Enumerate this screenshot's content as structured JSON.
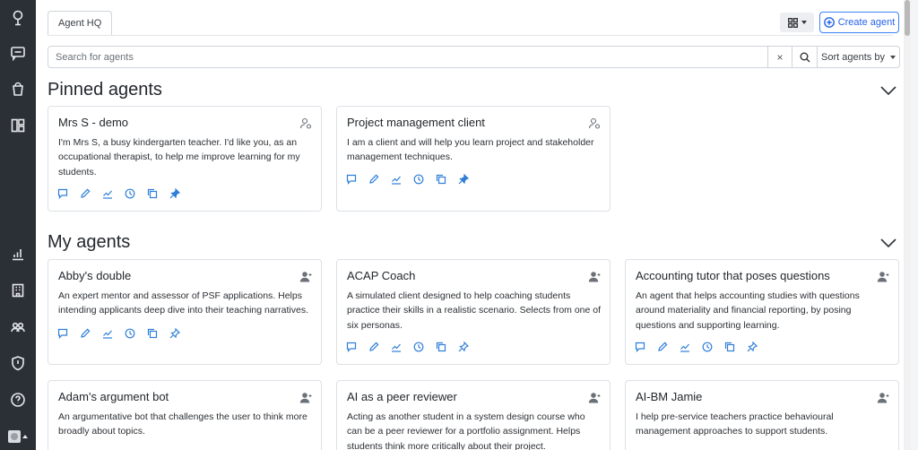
{
  "header": {
    "tab_label": "Agent HQ",
    "create_label": "Create agent"
  },
  "search": {
    "placeholder": "Search for agents",
    "clear_label": "×",
    "sort_label": "Sort agents by"
  },
  "sections": {
    "pinned_title": "Pinned agents",
    "my_title": "My agents"
  },
  "pinned": [
    {
      "title": "Mrs S - demo",
      "desc": "I'm Mrs S, a busy kindergarten teacher. I'd like you, as an occupational therapist, to help me improve learning for my students."
    },
    {
      "title": "Project management client",
      "desc": "I am a client and will help you learn project and stakeholder management techniques."
    }
  ],
  "agents": [
    {
      "title": "Abby's double",
      "desc": "An expert mentor and assessor of PSF applications. Helps intending applicants deep dive into their teaching narratives."
    },
    {
      "title": "ACAP Coach",
      "desc": "A simulated client designed to help coaching students practice their skills in a realistic scenario. Selects from one of six personas."
    },
    {
      "title": "Accounting tutor that poses questions",
      "desc": "An agent that helps accounting studies with questions around materiality and financial reporting, by posing questions and supporting learning."
    },
    {
      "title": "Adam's argument bot",
      "desc": "An argumentative bot that challenges the user to think more broadly about topics."
    },
    {
      "title": "AI as a peer reviewer",
      "desc": "Acting as another student in a system design course who can be a peer reviewer for a portfolio assignment. Helps students think more critically about their project."
    },
    {
      "title": "AI-BM Jamie",
      "desc": "I help pre-service teachers practice behavioural management approaches to support students."
    }
  ],
  "icons": {
    "sidebar": [
      "logo-icon",
      "chat-icon",
      "bucket-icon",
      "dashboard-icon",
      "analytics-icon",
      "building-icon",
      "users-icon",
      "shield-icon",
      "help-icon"
    ],
    "card_actions": [
      "chat-icon",
      "edit-icon",
      "analytics-icon",
      "history-icon",
      "copy-icon",
      "pin-icon"
    ]
  },
  "colors": {
    "sidebar_bg": "#2b2f36",
    "accent": "#2563eb",
    "action_icon": "#2f7fd8"
  }
}
